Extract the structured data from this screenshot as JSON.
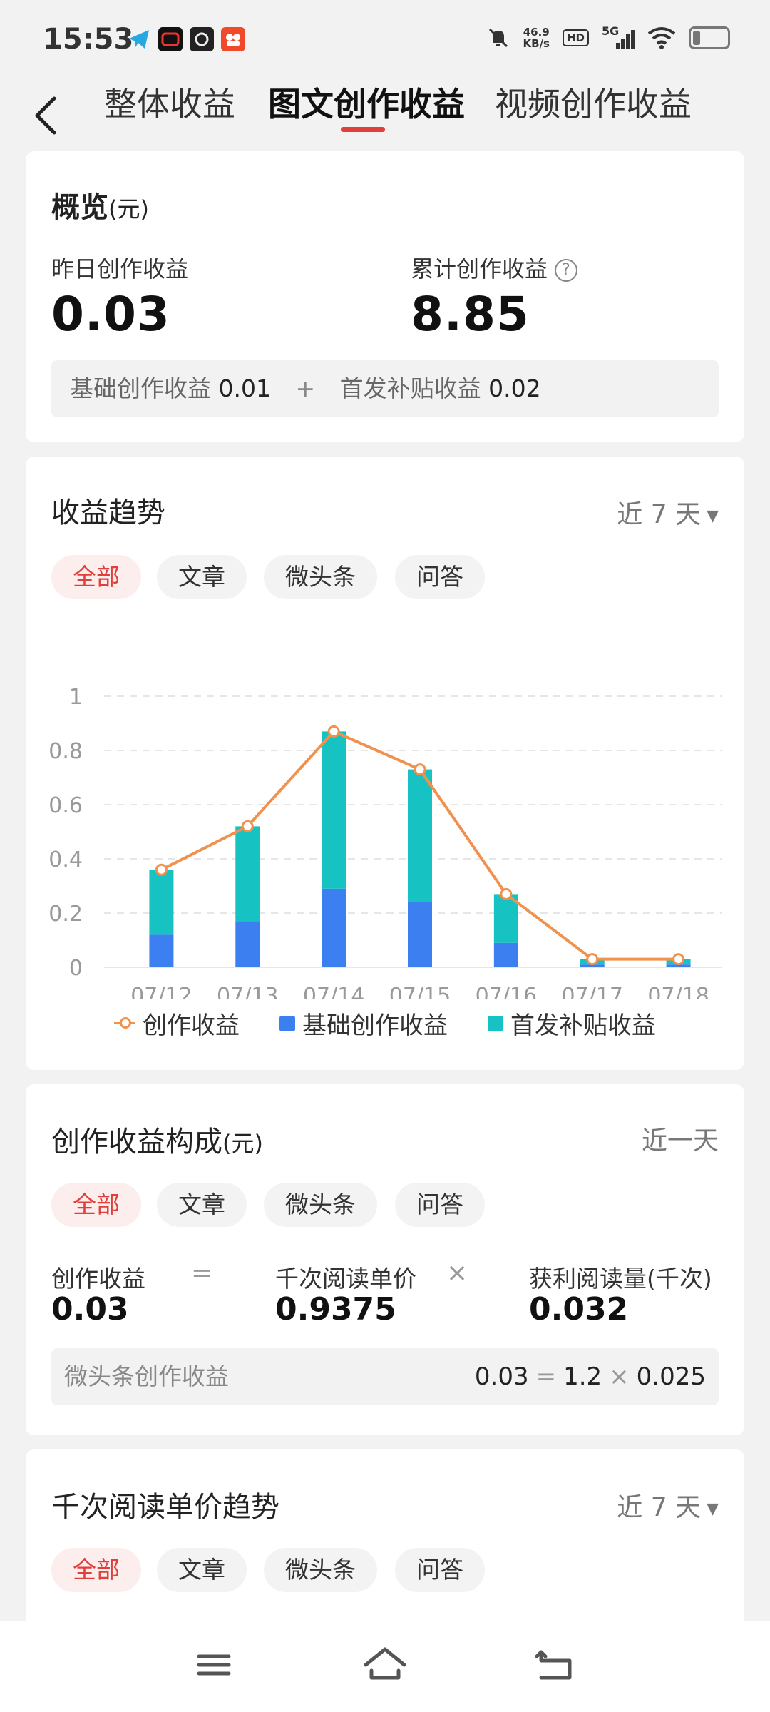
{
  "status": {
    "time": "15:53",
    "net_speed": "46.9",
    "net_unit": "KB/s",
    "hd": "HD",
    "signal": "5G"
  },
  "tabs": [
    {
      "label": "整体收益"
    },
    {
      "label": "图文创作收益"
    },
    {
      "label": "视频创作收益"
    }
  ],
  "overview": {
    "title": "概览",
    "unit": "(元)",
    "yesterday_label": "昨日创作收益",
    "yesterday_value": "0.03",
    "total_label": "累计创作收益",
    "total_value": "8.85",
    "help": "?",
    "breakdown": {
      "base_label": "基础创作收益",
      "base_value": "0.01",
      "plus": "+",
      "subsidy_label": "首发补贴收益",
      "subsidy_value": "0.02"
    }
  },
  "trend": {
    "title": "收益趋势",
    "range": "近 7 天",
    "filters": [
      "全部",
      "文章",
      "微头条",
      "问答"
    ]
  },
  "chart_data": {
    "type": "bar",
    "categories": [
      "07/12",
      "07/13",
      "07/14",
      "07/15",
      "07/16",
      "07/17",
      "07/18"
    ],
    "series": [
      {
        "name": "基础创作收益",
        "type": "bar",
        "stack": "total",
        "values": [
          0.12,
          0.17,
          0.29,
          0.24,
          0.09,
          0.01,
          0.01
        ]
      },
      {
        "name": "首发补贴收益",
        "type": "bar",
        "stack": "total",
        "values": [
          0.24,
          0.35,
          0.58,
          0.49,
          0.18,
          0.02,
          0.02
        ]
      },
      {
        "name": "创作收益",
        "type": "line",
        "values": [
          0.36,
          0.52,
          0.87,
          0.73,
          0.27,
          0.03,
          0.03
        ]
      }
    ],
    "yticks": [
      "0",
      "0.2",
      "0.4",
      "0.6",
      "0.8",
      "1"
    ],
    "ylim": [
      0,
      1
    ],
    "grid": true,
    "legend": "bottom",
    "colors": {
      "line": "#f0914e",
      "base": "#3b7ff0",
      "subsidy": "#16c2c2"
    }
  },
  "composition": {
    "title": "创作收益构成",
    "unit": "(元)",
    "range": "近一天",
    "filters": [
      "全部",
      "文章",
      "微头条",
      "问答"
    ],
    "earn_label": "创作收益",
    "earn_value": "0.03",
    "eq": "=",
    "price_label": "千次阅读单价",
    "price_value": "0.9375",
    "times": "×",
    "reads_label": "获利阅读量(千次)",
    "reads_value": "0.032",
    "row": {
      "label": "微头条创作收益",
      "earn": "0.03",
      "eq": "=",
      "price": "1.2",
      "times": "×",
      "reads": "0.025"
    }
  },
  "price_trend": {
    "title": "千次阅读单价趋势",
    "range": "近 7 天",
    "filters": [
      "全部",
      "文章",
      "微头条",
      "问答"
    ]
  },
  "colors": {
    "accent": "#e0403c",
    "pill_active_bg": "#fdeeee"
  }
}
